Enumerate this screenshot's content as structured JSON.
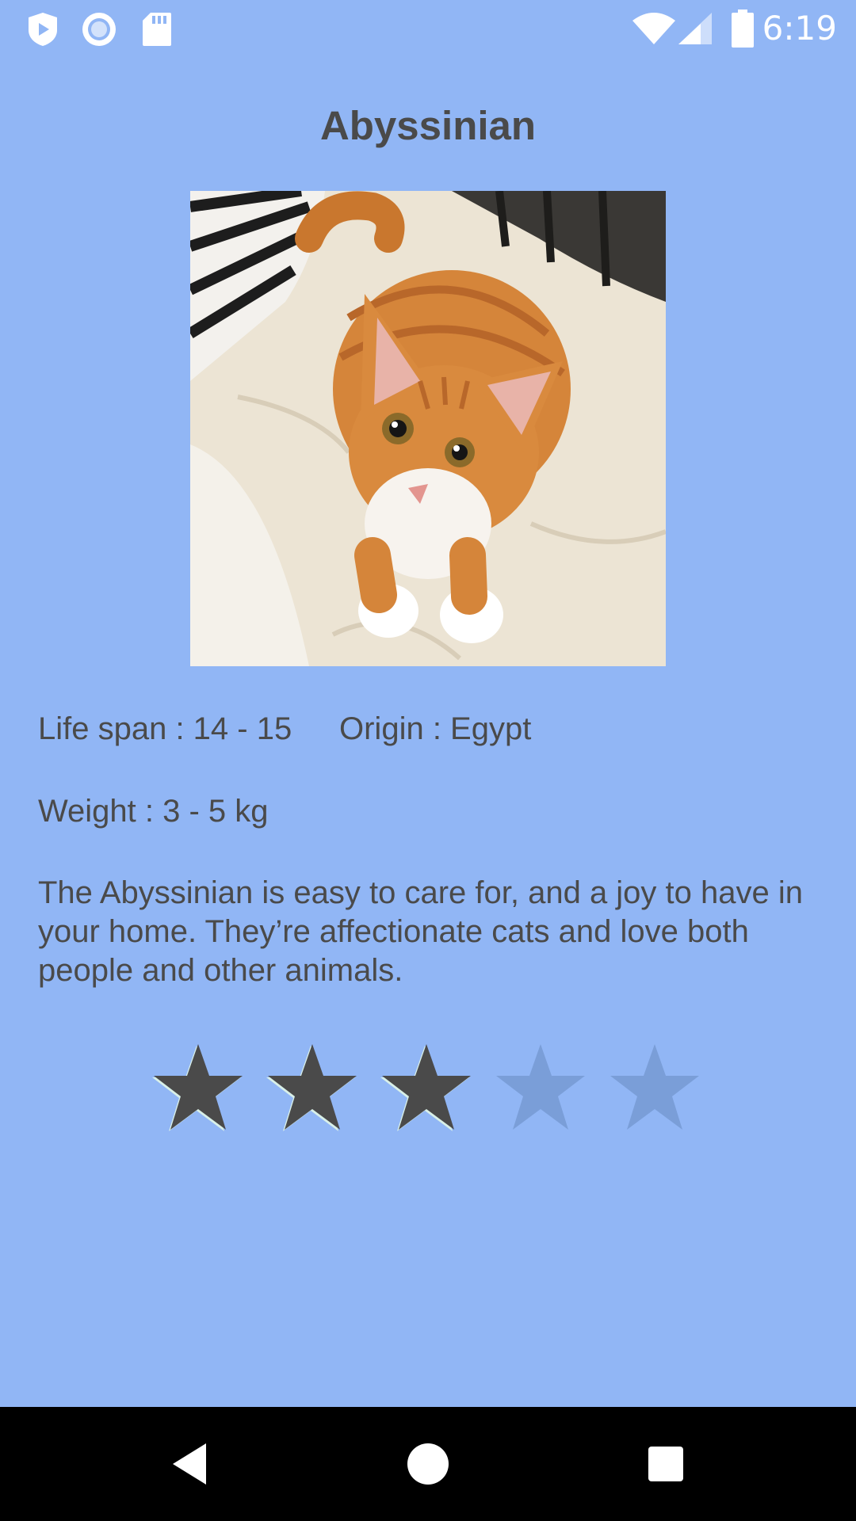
{
  "status_bar": {
    "time": "6:19",
    "left_icons": [
      "shield-play-icon",
      "circle-record-icon",
      "sd-card-icon"
    ],
    "right_icons": [
      "wifi-icon",
      "signal-icon",
      "battery-icon"
    ]
  },
  "breed": {
    "name": "Abyssinian",
    "image_icon": "cat-photo",
    "life_span": "Life span : 14 - 15",
    "origin": "Origin : Egypt",
    "weight": "Weight : 3 - 5 kg",
    "description": "The Abyssinian is easy to care for, and a joy to have in your home. They’re affectionate cats and love both people and other animals."
  },
  "rating": {
    "value": 3,
    "max": 5,
    "filled_color": "#4a4a4a",
    "empty_color": "#7a9ed8"
  },
  "colors": {
    "background": "#91b6f5",
    "text": "#4a4a4a",
    "nav_bar": "#000000"
  },
  "nav_bar": {
    "buttons": [
      "back-icon",
      "home-icon",
      "recents-icon"
    ]
  }
}
